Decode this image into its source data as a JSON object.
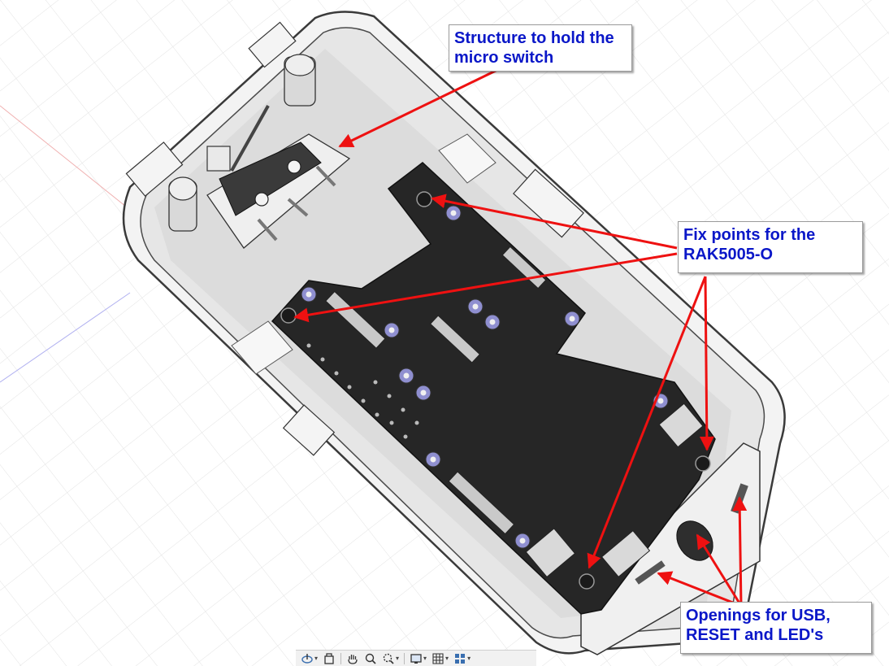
{
  "callouts": {
    "switch": {
      "line1": "Structure to hold the",
      "line2": "micro switch"
    },
    "fix_points": {
      "line1": "Fix points for the",
      "line2": "RAK5005-O"
    },
    "openings": {
      "line1": "Openings for USB,",
      "line2": "RESET and LED's"
    }
  },
  "toolbar": {
    "items": [
      {
        "name": "orbit-icon",
        "dropdown": true
      },
      {
        "name": "look-at-icon",
        "dropdown": false
      },
      {
        "name": "pan-icon",
        "dropdown": false
      },
      {
        "name": "zoom-icon",
        "dropdown": false
      },
      {
        "name": "fit-icon",
        "dropdown": true
      },
      {
        "name": "display-settings-icon",
        "dropdown": true
      },
      {
        "name": "grid-settings-icon",
        "dropdown": true
      },
      {
        "name": "viewports-icon",
        "dropdown": true
      }
    ]
  },
  "colors": {
    "annotation_text": "#0a17c8",
    "arrow": "#ee1111",
    "pcb": "#262626",
    "enclosure": "#e6e6e6",
    "washer": "#8f8fd0"
  }
}
